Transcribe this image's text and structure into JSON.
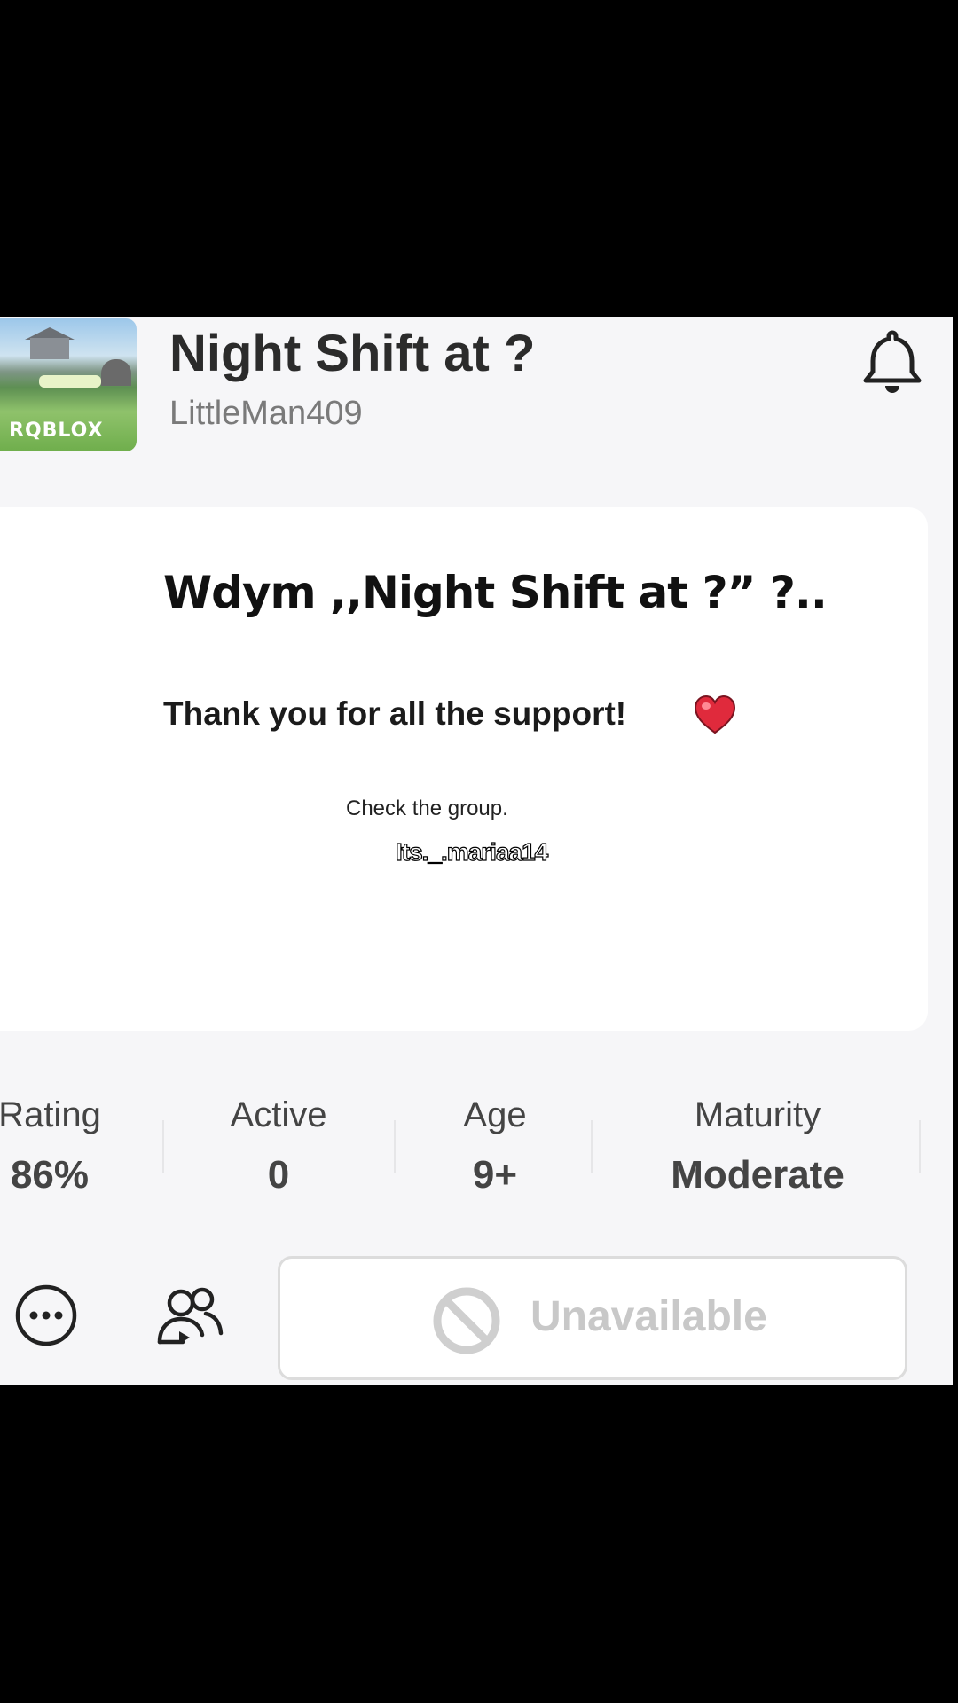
{
  "game": {
    "title": "Night Shift at ?",
    "creator": "LittleMan409",
    "thumbnail_logo": "RQBLOX"
  },
  "description": {
    "headline": "Wdym ,,Night Shift at ?” ?..",
    "thanks": "Thank you for all the support!",
    "note": "Check the group."
  },
  "watermark": "Its._.mariaa14",
  "stats": [
    {
      "label": "Rating",
      "value": "86%"
    },
    {
      "label": "Active",
      "value": "0"
    },
    {
      "label": "Age",
      "value": "9+"
    },
    {
      "label": "Maturity",
      "value": "Moderate"
    }
  ],
  "actions": {
    "play_label": "Unavailable",
    "icons": [
      "bell-icon",
      "more-icon",
      "party-icon",
      "ban-icon",
      "heart-emoji"
    ]
  },
  "colors": {
    "heart": "#e02a3c",
    "disabled": "#c8c8c8"
  }
}
